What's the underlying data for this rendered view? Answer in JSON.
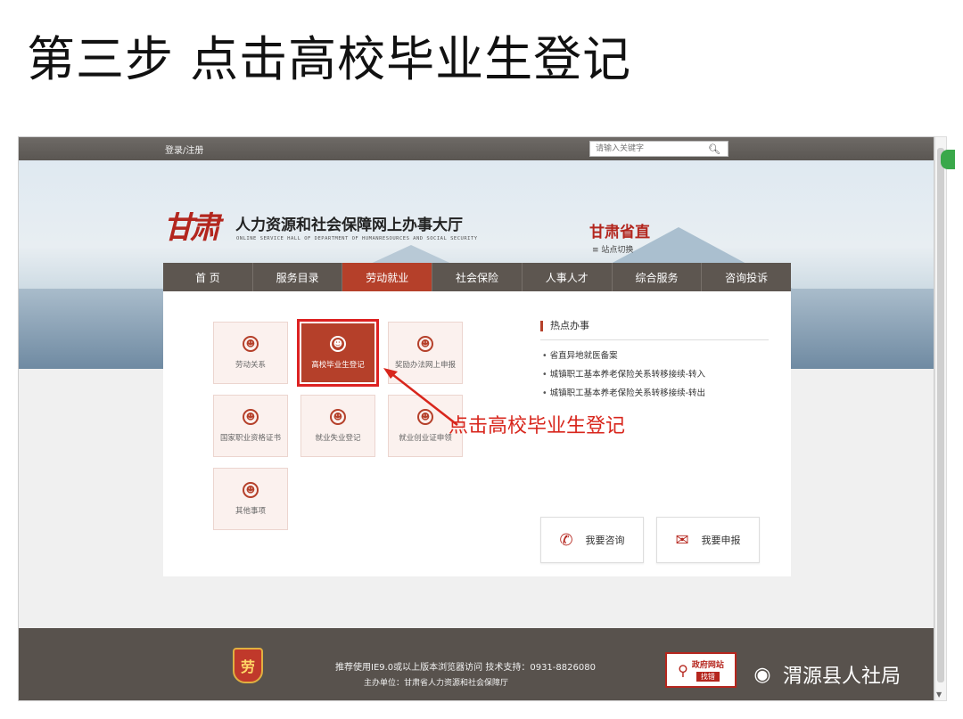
{
  "slide": {
    "title": "第三步 点击高校毕业生登记"
  },
  "topbar": {
    "login": "登录/注册",
    "search_placeholder": "请输入关键字"
  },
  "header": {
    "logo_text": "甘肃",
    "site_title": "人力资源和社会保障网上办事大厅",
    "site_subtitle": "ONLINE SERVICE HALL OF DEPARTMENT OF HUMANRESOURCES AND SOCIAL SECURITY",
    "province": "甘肃省直",
    "switch_label": "站点切换"
  },
  "nav": {
    "items": [
      "首 页",
      "服务目录",
      "劳动就业",
      "社会保险",
      "人事人才",
      "综合服务",
      "咨询投诉"
    ],
    "active_index": 2
  },
  "services": {
    "tiles": [
      "劳动关系",
      "高校毕业生登记",
      "奖励办法网上申报",
      "国家职业资格证书",
      "就业失业登记",
      "就业创业证申领",
      "其他事项"
    ],
    "active_index": 1
  },
  "hot": {
    "heading": "热点办事",
    "items": [
      "省直异地就医备案",
      "城镇职工基本养老保险关系转移接续-转入",
      "城镇职工基本养老保险关系转移接续-转出"
    ]
  },
  "actions": {
    "consult": "我要咨询",
    "report": "我要申报"
  },
  "annotation": {
    "text": "点击高校毕业生登记",
    "color": "#d8261c"
  },
  "footer": {
    "emblem_text": "劳",
    "line1": "推荐使用IE9.0或以上版本浏览器访问   技术支持：0931-8826080",
    "line2": "主办单位：甘肃省人力资源和社会保障厅",
    "gov_badge_line1": "政府网站",
    "gov_badge_line2": "找错"
  },
  "watermark": {
    "text": "渭源县人社局"
  },
  "colors": {
    "accent": "#b5402a",
    "nav_bg": "#5d5650",
    "footer_bg": "#58524d",
    "annotation": "#d8261c"
  }
}
